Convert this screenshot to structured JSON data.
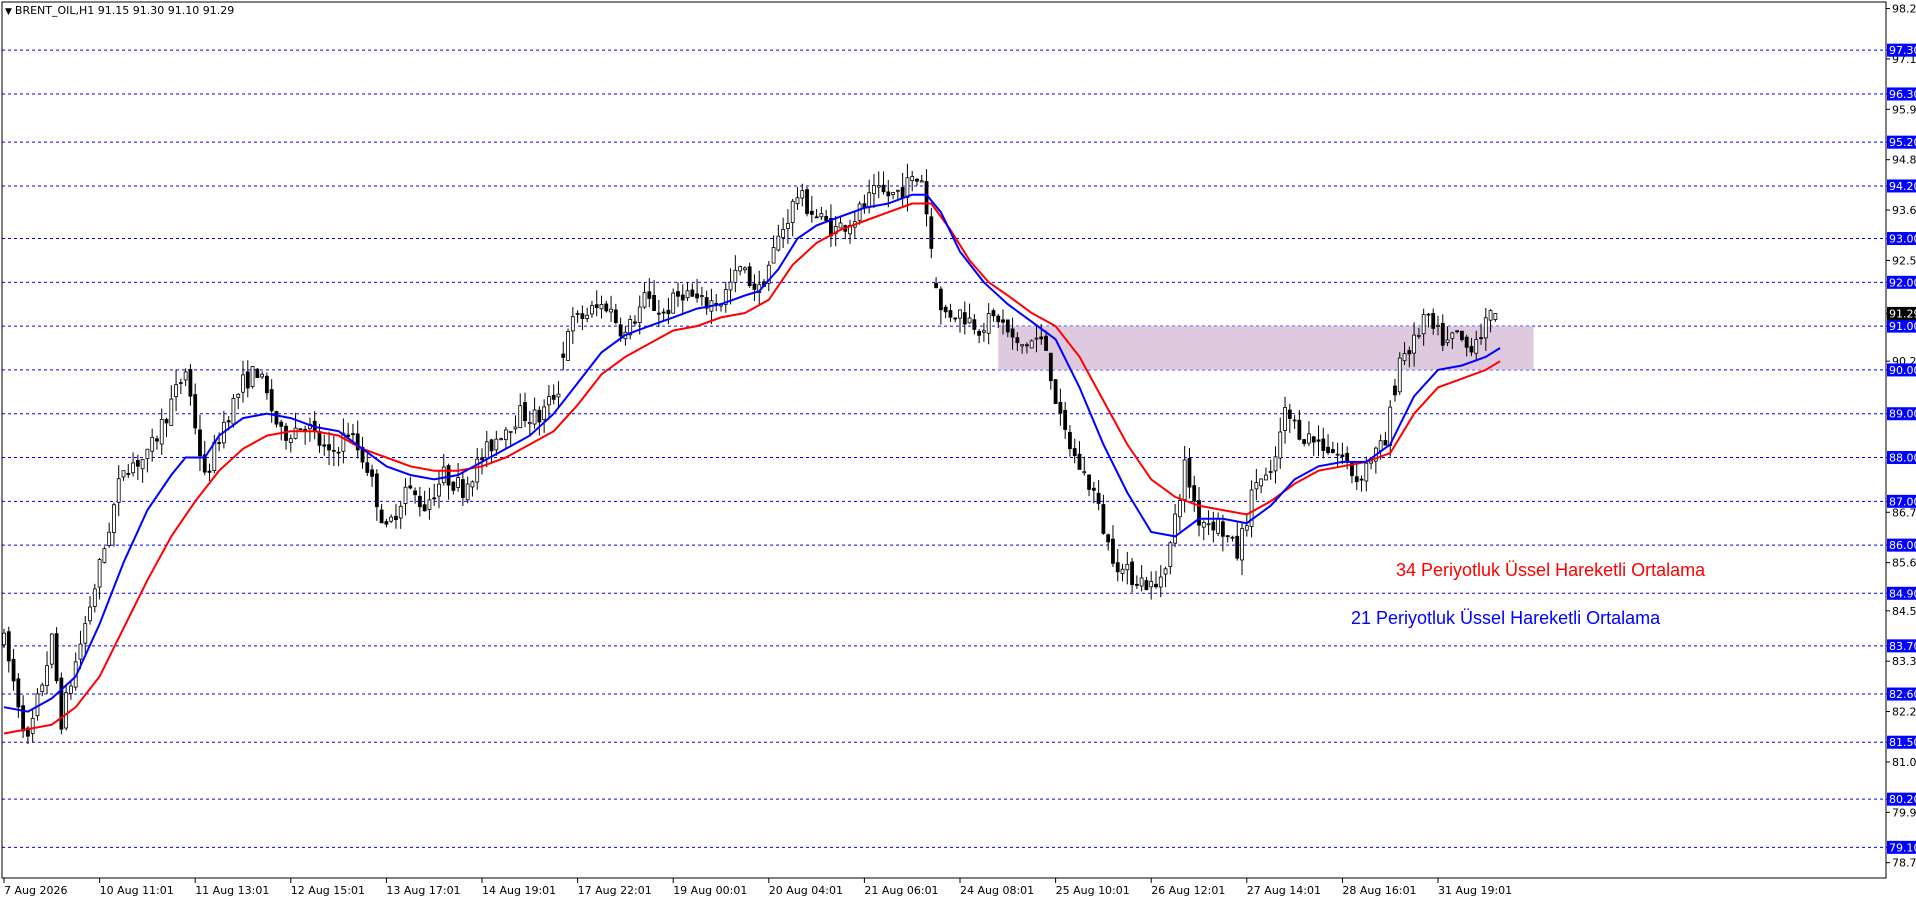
{
  "header": {
    "symbol_info": "BRENT_OIL,H1  91.15 91.30 91.10 91.29",
    "menu_icon": "triangle-down-icon"
  },
  "colors": {
    "background": "#ffffff",
    "candle": "#000000",
    "ema21": "#0000ff",
    "ema34": "#ff0000",
    "level_line": "#0000ff",
    "level_box": "#0000ff",
    "zone_fill": "#d8bfd8",
    "price_box": "#000000"
  },
  "annotations": {
    "ema34_label": "34  Periyotluk Üssel Hareketli Ortalama",
    "ema21_label": "21 Periyotluk Üssel Hareketli Ortalama"
  },
  "chart_data": {
    "type": "candlestick",
    "symbol": "BRENT_OIL",
    "timeframe": "H1",
    "last_ohlc": {
      "open": 91.15,
      "high": 91.3,
      "low": 91.1,
      "close": 91.29
    },
    "current_price": 91.29,
    "ylim": [
      78.4,
      98.4
    ],
    "y_ticks": [
      98.25,
      97.3,
      97.1,
      96.3,
      95.95,
      95.2,
      94.8,
      94.2,
      93.65,
      93.0,
      92.5,
      92.0,
      91.29,
      91.0,
      90.2,
      90.0,
      89.0,
      88.0,
      87.0,
      86.75,
      86.0,
      85.6,
      84.9,
      84.5,
      83.7,
      83.35,
      82.6,
      82.2,
      81.5,
      81.05,
      80.2,
      79.9,
      79.1,
      78.75
    ],
    "levels": [
      97.3,
      96.3,
      95.2,
      94.2,
      93.0,
      92.0,
      91.0,
      90.0,
      89.0,
      88.0,
      87.0,
      86.0,
      84.9,
      83.7,
      82.6,
      81.5,
      80.2,
      79.1
    ],
    "level_labels": [
      "97.30",
      "96.30",
      "95.20",
      "94.20",
      "93.00",
      "92.00",
      "91.00",
      "90.00",
      "89.00",
      "88.00",
      "87.00",
      "86.00",
      "84.90",
      "83.70",
      "82.60",
      "81.50",
      "80.20",
      "79.10"
    ],
    "price_label": "91.29",
    "zone": {
      "from_price": 90.0,
      "to_price": 91.0,
      "from_bar": 208,
      "to_bar": 320
    },
    "x_labels": [
      {
        "bar": 0,
        "label": "7 Aug 2026"
      },
      {
        "bar": 20,
        "label": "10 Aug 11:01"
      },
      {
        "bar": 40,
        "label": "11 Aug 13:01"
      },
      {
        "bar": 60,
        "label": "12 Aug 15:01"
      },
      {
        "bar": 80,
        "label": "13 Aug 17:01"
      },
      {
        "bar": 100,
        "label": "14 Aug 19:01"
      },
      {
        "bar": 120,
        "label": "17 Aug 22:01"
      },
      {
        "bar": 140,
        "label": "19 Aug 00:01"
      },
      {
        "bar": 160,
        "label": "20 Aug 04:01"
      },
      {
        "bar": 180,
        "label": "21 Aug 06:01"
      },
      {
        "bar": 200,
        "label": "24 Aug 08:01"
      },
      {
        "bar": 220,
        "label": "25 Aug 10:01"
      },
      {
        "bar": 240,
        "label": "26 Aug 12:01"
      },
      {
        "bar": 260,
        "label": "27 Aug 14:01"
      },
      {
        "bar": 280,
        "label": "28 Aug 16:01"
      },
      {
        "bar": 300,
        "label": "31 Aug 19:01"
      }
    ],
    "close_path": [
      [
        0,
        83.8
      ],
      [
        5,
        81.5
      ],
      [
        10,
        83.8
      ],
      [
        12,
        82.0
      ],
      [
        17,
        84.2
      ],
      [
        20,
        85.5
      ],
      [
        25,
        87.8
      ],
      [
        30,
        88.0
      ],
      [
        36,
        89.5
      ],
      [
        38,
        90.0
      ],
      [
        42,
        87.5
      ],
      [
        46,
        88.8
      ],
      [
        50,
        89.7
      ],
      [
        53,
        90.0
      ],
      [
        58,
        88.5
      ],
      [
        63,
        88.8
      ],
      [
        68,
        88.0
      ],
      [
        72,
        88.6
      ],
      [
        76,
        87.8
      ],
      [
        80,
        86.3
      ],
      [
        84,
        87.3
      ],
      [
        88,
        86.9
      ],
      [
        92,
        87.6
      ],
      [
        96,
        87.3
      ],
      [
        100,
        88.0
      ],
      [
        104,
        88.6
      ],
      [
        108,
        89.0
      ],
      [
        112,
        88.9
      ],
      [
        116,
        89.6
      ],
      [
        118,
        91.0
      ],
      [
        122,
        91.3
      ],
      [
        126,
        91.5
      ],
      [
        130,
        90.8
      ],
      [
        134,
        91.6
      ],
      [
        138,
        91.3
      ],
      [
        142,
        91.8
      ],
      [
        146,
        91.5
      ],
      [
        150,
        91.6
      ],
      [
        154,
        92.3
      ],
      [
        158,
        91.8
      ],
      [
        162,
        93.0
      ],
      [
        166,
        94.0
      ],
      [
        170,
        93.5
      ],
      [
        174,
        93.2
      ],
      [
        178,
        93.5
      ],
      [
        182,
        94.0
      ],
      [
        186,
        94.0
      ],
      [
        190,
        94.3
      ],
      [
        192,
        94.4
      ],
      [
        194,
        92.8
      ],
      [
        196,
        91.3
      ],
      [
        200,
        91.3
      ],
      [
        204,
        91.0
      ],
      [
        208,
        91.2
      ],
      [
        212,
        90.5
      ],
      [
        216,
        90.7
      ],
      [
        218,
        90.5
      ],
      [
        221,
        88.8
      ],
      [
        224,
        88.0
      ],
      [
        228,
        87.2
      ],
      [
        231,
        86.0
      ],
      [
        234,
        85.4
      ],
      [
        238,
        85.2
      ],
      [
        241,
        85.0
      ],
      [
        244,
        86.0
      ],
      [
        247,
        87.8
      ],
      [
        250,
        86.6
      ],
      [
        254,
        86.5
      ],
      [
        258,
        85.8
      ],
      [
        262,
        87.5
      ],
      [
        265,
        87.5
      ],
      [
        268,
        89.0
      ],
      [
        272,
        88.5
      ],
      [
        276,
        88.3
      ],
      [
        280,
        88.0
      ],
      [
        283,
        87.5
      ],
      [
        286,
        88.0
      ],
      [
        289,
        88.3
      ],
      [
        292,
        90.3
      ],
      [
        295,
        90.6
      ],
      [
        297,
        91.2
      ],
      [
        299,
        90.9
      ],
      [
        302,
        90.6
      ],
      [
        304,
        90.8
      ],
      [
        306,
        90.5
      ],
      [
        310,
        91.0
      ],
      [
        312,
        91.29
      ]
    ],
    "series": [
      {
        "name": "21 Periyotluk Üssel Hareketli Ortalama",
        "kind": "ema",
        "period": 21,
        "color": "#0000ff",
        "points": [
          [
            0,
            82.3
          ],
          [
            5,
            82.2
          ],
          [
            10,
            82.5
          ],
          [
            15,
            83.0
          ],
          [
            20,
            84.2
          ],
          [
            25,
            85.6
          ],
          [
            30,
            86.8
          ],
          [
            35,
            87.6
          ],
          [
            38,
            88.0
          ],
          [
            42,
            88.0
          ],
          [
            45,
            88.5
          ],
          [
            50,
            88.9
          ],
          [
            55,
            89.0
          ],
          [
            60,
            88.9
          ],
          [
            65,
            88.7
          ],
          [
            70,
            88.6
          ],
          [
            75,
            88.2
          ],
          [
            80,
            87.8
          ],
          [
            85,
            87.6
          ],
          [
            90,
            87.5
          ],
          [
            95,
            87.6
          ],
          [
            100,
            87.9
          ],
          [
            105,
            88.2
          ],
          [
            110,
            88.5
          ],
          [
            115,
            89.0
          ],
          [
            120,
            89.7
          ],
          [
            125,
            90.4
          ],
          [
            130,
            90.8
          ],
          [
            135,
            91.0
          ],
          [
            140,
            91.2
          ],
          [
            145,
            91.4
          ],
          [
            150,
            91.5
          ],
          [
            155,
            91.7
          ],
          [
            158,
            91.8
          ],
          [
            162,
            92.3
          ],
          [
            166,
            93.0
          ],
          [
            170,
            93.3
          ],
          [
            175,
            93.5
          ],
          [
            180,
            93.7
          ],
          [
            185,
            93.8
          ],
          [
            190,
            94.0
          ],
          [
            193,
            94.0
          ],
          [
            196,
            93.6
          ],
          [
            200,
            92.7
          ],
          [
            205,
            92.0
          ],
          [
            210,
            91.5
          ],
          [
            215,
            91.1
          ],
          [
            220,
            90.7
          ],
          [
            225,
            89.6
          ],
          [
            230,
            88.3
          ],
          [
            235,
            87.2
          ],
          [
            240,
            86.3
          ],
          [
            245,
            86.2
          ],
          [
            250,
            86.6
          ],
          [
            255,
            86.6
          ],
          [
            260,
            86.5
          ],
          [
            265,
            86.9
          ],
          [
            270,
            87.5
          ],
          [
            275,
            87.8
          ],
          [
            280,
            87.9
          ],
          [
            285,
            87.9
          ],
          [
            290,
            88.3
          ],
          [
            295,
            89.4
          ],
          [
            300,
            90.0
          ],
          [
            305,
            90.1
          ],
          [
            310,
            90.3
          ],
          [
            313,
            90.5
          ]
        ]
      },
      {
        "name": "34  Periyotluk Üssel Hareketli Ortalama",
        "kind": "ema",
        "period": 34,
        "color": "#ff0000",
        "points": [
          [
            0,
            81.7
          ],
          [
            5,
            81.8
          ],
          [
            10,
            81.9
          ],
          [
            15,
            82.3
          ],
          [
            20,
            83.0
          ],
          [
            25,
            84.1
          ],
          [
            30,
            85.2
          ],
          [
            35,
            86.2
          ],
          [
            40,
            87.0
          ],
          [
            45,
            87.7
          ],
          [
            50,
            88.2
          ],
          [
            55,
            88.5
          ],
          [
            60,
            88.6
          ],
          [
            65,
            88.6
          ],
          [
            70,
            88.5
          ],
          [
            75,
            88.2
          ],
          [
            80,
            88.0
          ],
          [
            85,
            87.8
          ],
          [
            90,
            87.7
          ],
          [
            95,
            87.7
          ],
          [
            100,
            87.8
          ],
          [
            105,
            88.0
          ],
          [
            110,
            88.3
          ],
          [
            115,
            88.6
          ],
          [
            120,
            89.2
          ],
          [
            125,
            89.9
          ],
          [
            130,
            90.3
          ],
          [
            135,
            90.6
          ],
          [
            140,
            90.9
          ],
          [
            145,
            91.0
          ],
          [
            150,
            91.2
          ],
          [
            155,
            91.3
          ],
          [
            160,
            91.6
          ],
          [
            165,
            92.4
          ],
          [
            170,
            92.9
          ],
          [
            175,
            93.2
          ],
          [
            180,
            93.4
          ],
          [
            185,
            93.6
          ],
          [
            190,
            93.8
          ],
          [
            194,
            93.8
          ],
          [
            198,
            93.2
          ],
          [
            202,
            92.5
          ],
          [
            206,
            92.0
          ],
          [
            210,
            91.7
          ],
          [
            215,
            91.3
          ],
          [
            220,
            91.0
          ],
          [
            225,
            90.3
          ],
          [
            230,
            89.3
          ],
          [
            235,
            88.3
          ],
          [
            240,
            87.5
          ],
          [
            245,
            87.1
          ],
          [
            250,
            86.9
          ],
          [
            255,
            86.8
          ],
          [
            260,
            86.7
          ],
          [
            265,
            87.0
          ],
          [
            270,
            87.4
          ],
          [
            275,
            87.7
          ],
          [
            280,
            87.8
          ],
          [
            285,
            87.9
          ],
          [
            290,
            88.1
          ],
          [
            295,
            89.0
          ],
          [
            300,
            89.6
          ],
          [
            305,
            89.8
          ],
          [
            310,
            90.0
          ],
          [
            313,
            90.2
          ]
        ]
      }
    ]
  }
}
